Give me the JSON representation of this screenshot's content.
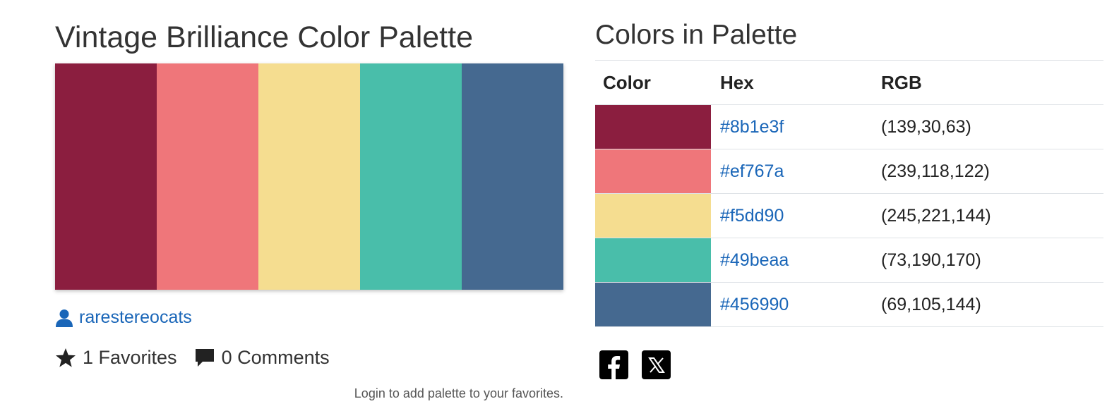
{
  "palette": {
    "title": "Vintage Brilliance Color Palette",
    "colors": [
      "#8b1e3f",
      "#ef767a",
      "#f5dd90",
      "#49beaa",
      "#456990"
    ],
    "author": "rarestereocats",
    "favorites_text": "1 Favorites",
    "comments_text": "0 Comments",
    "login_note": "Login to add palette to your favorites."
  },
  "table": {
    "section_title": "Colors in Palette",
    "headers": {
      "color": "Color",
      "hex": "Hex",
      "rgb": "RGB"
    },
    "rows": [
      {
        "hex": "#8b1e3f",
        "rgb": "(139,30,63)"
      },
      {
        "hex": "#ef767a",
        "rgb": "(239,118,122)"
      },
      {
        "hex": "#f5dd90",
        "rgb": "(245,221,144)"
      },
      {
        "hex": "#49beaa",
        "rgb": "(73,190,170)"
      },
      {
        "hex": "#456990",
        "rgb": "(69,105,144)"
      }
    ]
  },
  "share": {
    "icons": [
      "facebook-icon",
      "x-icon"
    ]
  },
  "colors": {
    "link": "#1a66b8",
    "text": "#333333"
  }
}
